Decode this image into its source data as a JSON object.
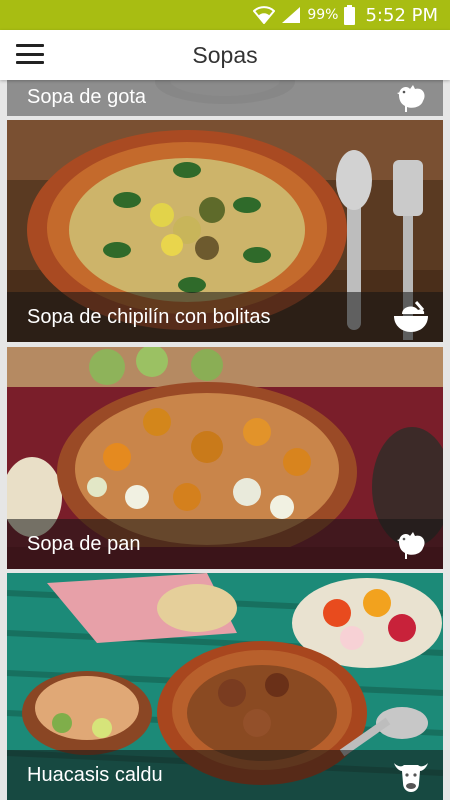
{
  "status": {
    "battery": "99%",
    "time": "5:52 PM"
  },
  "header": {
    "title": "Sopas"
  },
  "soups": [
    {
      "name": "Sopa de gota",
      "category_icon": "chicken-icon"
    },
    {
      "name": "Sopa de chipilín con bolitas",
      "category_icon": "bowl-icon"
    },
    {
      "name": "Sopa de pan",
      "category_icon": "chicken-icon"
    },
    {
      "name": "Huacasis caldu",
      "category_icon": "cow-icon"
    }
  ],
  "colors": {
    "status_bar": "#a8bd12",
    "app_bar": "#ffffff"
  }
}
